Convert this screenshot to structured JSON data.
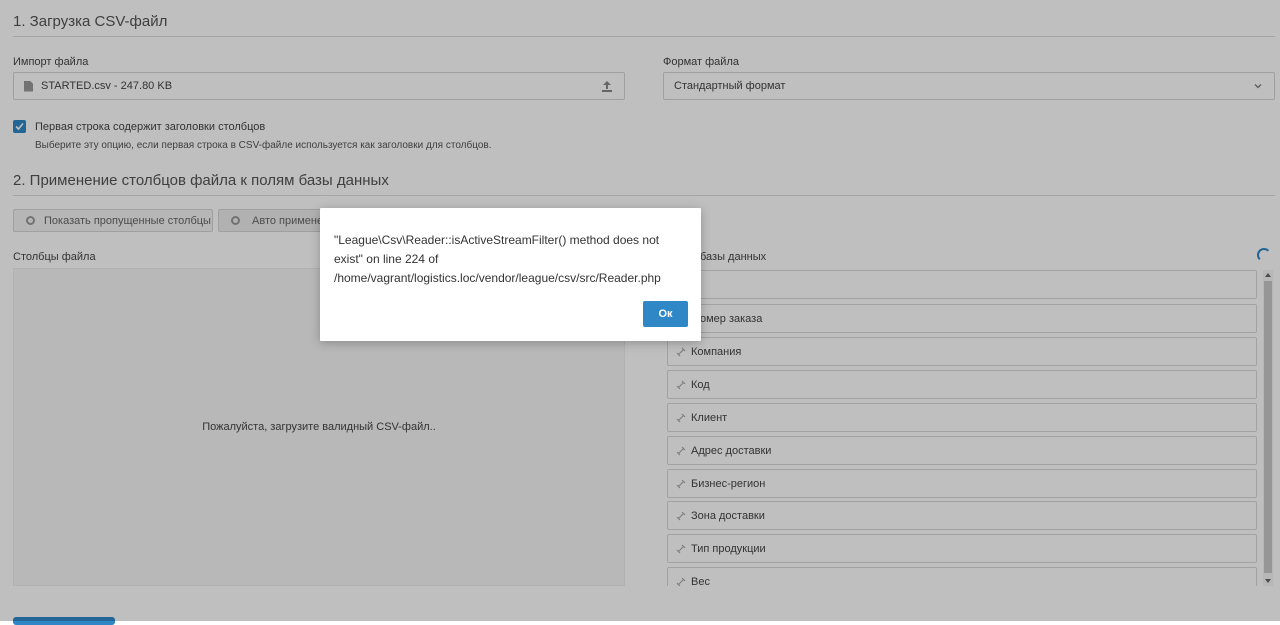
{
  "section1": {
    "title": "1. Загрузка CSV-файл",
    "import_label": "Импорт файла",
    "file_value": "STARTED.csv - 247.80 KB",
    "format_label": "Формат файла",
    "format_value": "Стандартный формат",
    "checkbox_label": "Первая строка содержит заголовки столбцов",
    "checkbox_checked": true,
    "checkbox_help": "Выберите эту опцию, если первая строка в CSV-файле используется как заголовки для столбцов."
  },
  "section2": {
    "title": "2. Применение столбцов файла к полям базы данных",
    "show_skipped_label": "Показать пропущенные столбцы",
    "auto_apply_label": "Авто применен",
    "file_columns_label": "Столбцы файла",
    "db_columns_label": "базы данных",
    "dropzone_text": "Пожалуйста, загрузите валидный CSV-файл..",
    "db_items": [
      "",
      "омер заказа",
      "Компания",
      "Код",
      "Клиент",
      "Адрес доставки",
      "Бизнес-регион",
      "Зона доставки",
      "Тип продукции",
      "Вес"
    ]
  },
  "modal": {
    "message": "\"League\\Csv\\Reader::isActiveStreamFilter() method does not exist\" on line 224 of /home/vagrant/logistics.loc/vendor/league/csv/src/Reader.php",
    "ok_label": "Ок"
  },
  "colors": {
    "accent": "#2f87c6"
  }
}
